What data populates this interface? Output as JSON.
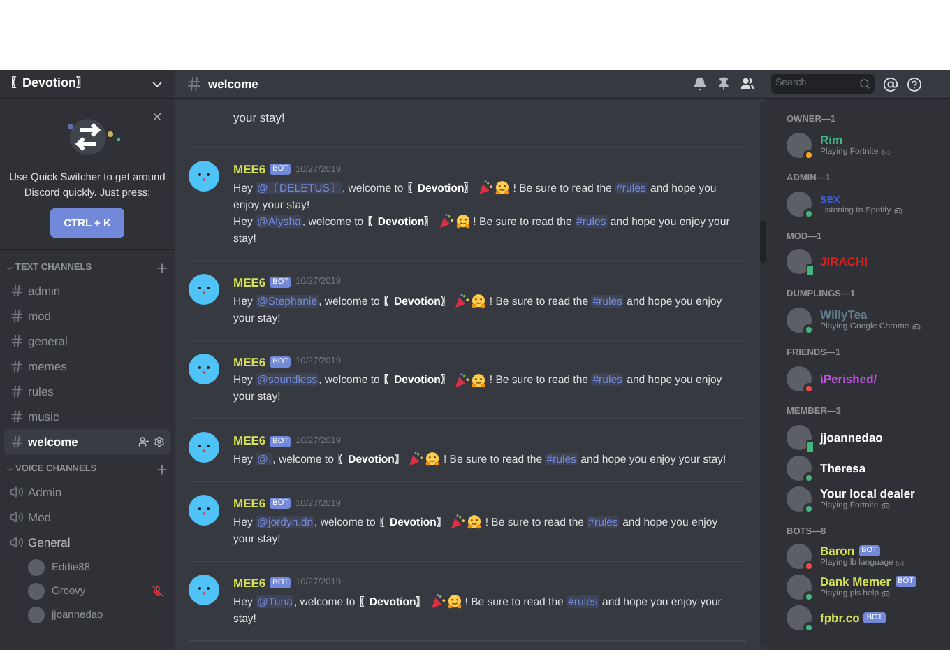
{
  "server": {
    "name": "〖Devotion〗"
  },
  "quick_switcher": {
    "text": "Use Quick Switcher to get around Discord quickly. Just press:",
    "button": "CTRL + K"
  },
  "text_channels": {
    "title": "TEXT CHANNELS",
    "items": [
      {
        "name": "admin",
        "selected": false
      },
      {
        "name": "mod",
        "selected": false
      },
      {
        "name": "general",
        "selected": false
      },
      {
        "name": "memes",
        "selected": false
      },
      {
        "name": "rules",
        "selected": false
      },
      {
        "name": "music",
        "selected": false
      },
      {
        "name": "welcome",
        "selected": true
      }
    ]
  },
  "voice_channels": {
    "title": "VOICE CHANNELS",
    "items": [
      {
        "name": "Admin",
        "expanded": false
      },
      {
        "name": "Mod",
        "expanded": false
      },
      {
        "name": "General",
        "expanded": true,
        "users": [
          {
            "name": "Eddie88",
            "muted": false
          },
          {
            "name": "Groovy",
            "muted": true
          },
          {
            "name": "jjoannedao",
            "muted": false
          }
        ]
      }
    ]
  },
  "channel_header": {
    "name": "welcome",
    "search_placeholder": "Search"
  },
  "partial_message": {
    "text": "your stay!"
  },
  "messages": [
    {
      "author": "MEE6",
      "badge": "BOT",
      "time": "10/27/2019",
      "lines": [
        [
          {
            "kind": "text",
            "text": "Hey "
          },
          {
            "kind": "mention",
            "text": "@〔DELETUS〕"
          },
          {
            "kind": "text",
            "text": ", welcome to "
          },
          {
            "kind": "bold",
            "text": "〖Devotion〗"
          },
          {
            "kind": "emoji"
          },
          {
            "kind": "text",
            "text": "! Be sure to read the "
          },
          {
            "kind": "mention",
            "text": "#rules"
          },
          {
            "kind": "text",
            "text": " and hope you enjoy your stay!"
          }
        ],
        [
          {
            "kind": "text",
            "text": "Hey "
          },
          {
            "kind": "mention",
            "text": "@Alysha"
          },
          {
            "kind": "text",
            "text": ", welcome to "
          },
          {
            "kind": "bold",
            "text": "〖Devotion〗"
          },
          {
            "kind": "emoji"
          },
          {
            "kind": "text",
            "text": "! Be sure to read the "
          },
          {
            "kind": "mention",
            "text": "#rules"
          },
          {
            "kind": "text",
            "text": " and hope you enjoy your stay!"
          }
        ]
      ]
    },
    {
      "author": "MEE6",
      "badge": "BOT",
      "time": "10/27/2019",
      "lines": [
        [
          {
            "kind": "text",
            "text": "Hey "
          },
          {
            "kind": "mention",
            "text": "@Stephanie"
          },
          {
            "kind": "text",
            "text": ", welcome to "
          },
          {
            "kind": "bold",
            "text": "〖Devotion〗"
          },
          {
            "kind": "emoji"
          },
          {
            "kind": "text",
            "text": "! Be sure to read the "
          },
          {
            "kind": "mention",
            "text": "#rules"
          },
          {
            "kind": "text",
            "text": " and hope you enjoy your stay!"
          }
        ]
      ]
    },
    {
      "author": "MEE6",
      "badge": "BOT",
      "time": "10/27/2019",
      "lines": [
        [
          {
            "kind": "text",
            "text": "Hey "
          },
          {
            "kind": "mention",
            "text": "@soundless"
          },
          {
            "kind": "text",
            "text": ", welcome to "
          },
          {
            "kind": "bold",
            "text": "〖Devotion〗"
          },
          {
            "kind": "emoji"
          },
          {
            "kind": "text",
            "text": "! Be sure to read the "
          },
          {
            "kind": "mention",
            "text": "#rules"
          },
          {
            "kind": "text",
            "text": " and hope you enjoy your stay!"
          }
        ]
      ]
    },
    {
      "author": "MEE6",
      "badge": "BOT",
      "time": "10/27/2019",
      "lines": [
        [
          {
            "kind": "text",
            "text": "Hey "
          },
          {
            "kind": "mention",
            "text": "@."
          },
          {
            "kind": "text",
            "text": ", welcome to "
          },
          {
            "kind": "bold",
            "text": "〖Devotion〗"
          },
          {
            "kind": "emoji"
          },
          {
            "kind": "text",
            "text": "! Be sure to read the "
          },
          {
            "kind": "mention",
            "text": "#rules"
          },
          {
            "kind": "text",
            "text": " and hope you enjoy your stay!"
          }
        ]
      ]
    },
    {
      "author": "MEE6",
      "badge": "BOT",
      "time": "10/27/2019",
      "lines": [
        [
          {
            "kind": "text",
            "text": "Hey "
          },
          {
            "kind": "mention",
            "text": "@jordyn.dn"
          },
          {
            "kind": "text",
            "text": ", welcome to "
          },
          {
            "kind": "bold",
            "text": "〖Devotion〗"
          },
          {
            "kind": "emoji"
          },
          {
            "kind": "text",
            "text": "! Be sure to read the "
          },
          {
            "kind": "mention",
            "text": "#rules"
          },
          {
            "kind": "text",
            "text": " and hope you enjoy your stay!"
          }
        ]
      ]
    },
    {
      "author": "MEE6",
      "badge": "BOT",
      "time": "10/27/2019",
      "lines": [
        [
          {
            "kind": "text",
            "text": "Hey "
          },
          {
            "kind": "mention",
            "text": "@Tuna"
          },
          {
            "kind": "text",
            "text": ", welcome to "
          },
          {
            "kind": "bold",
            "text": "〖Devotion〗"
          },
          {
            "kind": "emoji"
          },
          {
            "kind": "text",
            "text": "! Be sure to read the "
          },
          {
            "kind": "mention",
            "text": "#rules"
          },
          {
            "kind": "text",
            "text": " and hope you enjoy your stay!"
          }
        ]
      ]
    }
  ],
  "member_groups": [
    {
      "title": "OWNER—1",
      "color": "#43b581",
      "members": [
        {
          "name": "Rim",
          "activity": "Playing Fortnite",
          "color": "#faa61a",
          "mobile": false
        }
      ]
    },
    {
      "title": "ADMIN—1",
      "color": "#3b5fd9",
      "members": [
        {
          "name": "sex",
          "activity": "Listening to Spotify",
          "color": "#43b581",
          "mobile": false
        }
      ]
    },
    {
      "title": "MOD—1",
      "color": "#e01e1e",
      "members": [
        {
          "name": "JIRACHI",
          "color": "#43b581",
          "mobile": true
        }
      ]
    },
    {
      "title": "DUMPLINGS—1",
      "color": "#607d8b",
      "members": [
        {
          "name": "WillyTea",
          "activity": "Playing Google Chrome",
          "color": "#43b581",
          "mobile": false
        }
      ]
    },
    {
      "title": "FRIENDS—1",
      "color": "#c04ee0",
      "members": [
        {
          "name": "\\Perished/",
          "color": "#f04747",
          "mobile": false
        }
      ]
    },
    {
      "title": "MEMBER—3",
      "color": "#ffffff",
      "members": [
        {
          "name": "jjoannedao",
          "color": "#43b581",
          "mobile": true
        },
        {
          "name": "Theresa",
          "color": "#43b581",
          "mobile": false
        },
        {
          "name": "Your local dealer",
          "activity": "Playing Fortnite",
          "color": "#43b581",
          "mobile": false
        }
      ]
    },
    {
      "title": "BOTS—8",
      "color": "#d4e157",
      "members": [
        {
          "name": "Baron",
          "activity": "Playing lb language",
          "color": "#f04747",
          "mobile": false,
          "badge": "BOT"
        },
        {
          "name": "Dank Memer",
          "activity": "Playing pls help",
          "color": "#43b581",
          "mobile": false,
          "badge": "BOT"
        },
        {
          "name": "fpbr.co",
          "color": "#43b581",
          "mobile": false,
          "badge": "BOT"
        }
      ]
    }
  ]
}
